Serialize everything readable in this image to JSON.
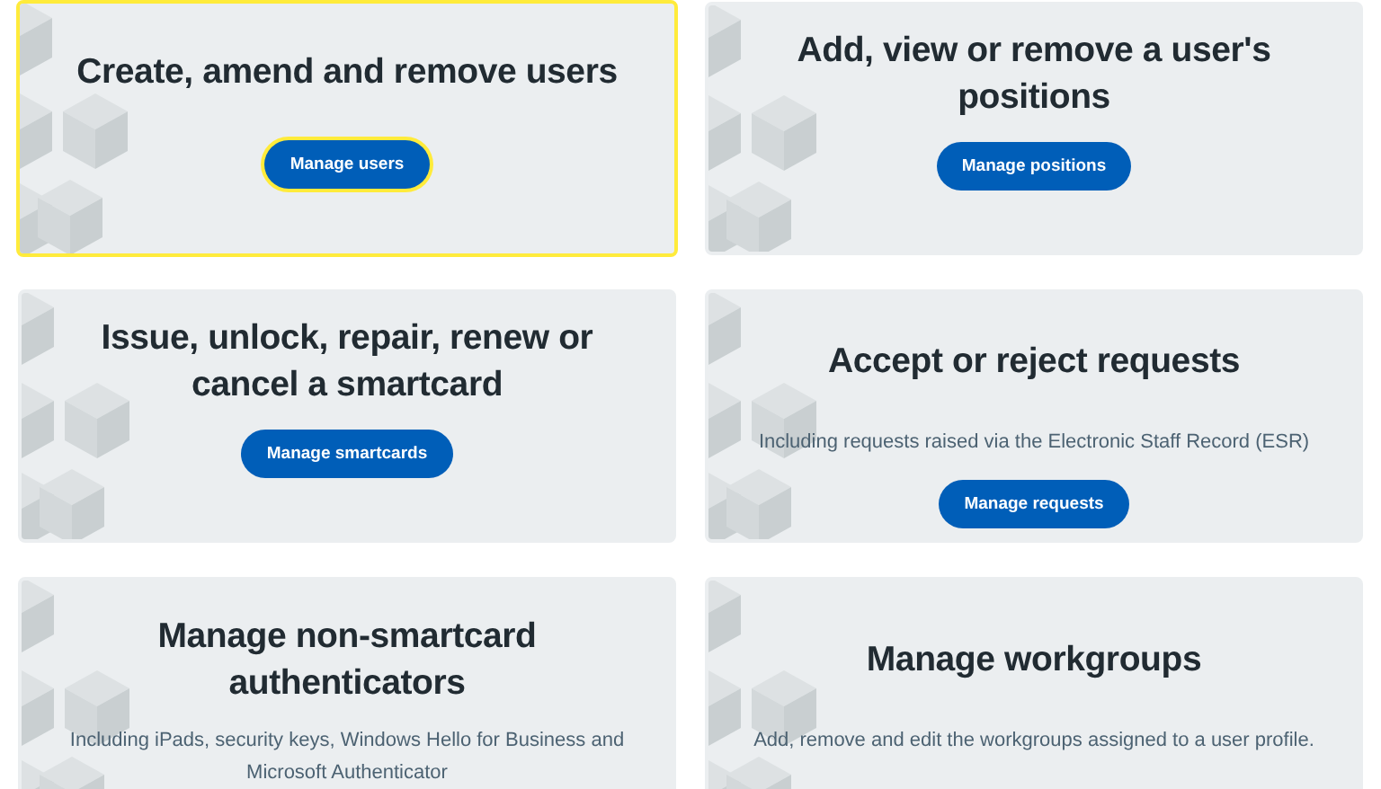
{
  "cards": [
    {
      "title": "Create, amend and remove users",
      "button": "Manage users",
      "focused": true
    },
    {
      "title": "Add, view or remove a user's positions",
      "button": "Manage positions",
      "focused": false
    },
    {
      "title": "Issue, unlock, repair, renew or cancel a smartcard",
      "button": "Manage smartcards",
      "focused": false
    },
    {
      "title": "Accept or reject requests",
      "description": "Including requests raised via the Electronic Staff Record (ESR)",
      "button": "Manage requests",
      "focused": false
    },
    {
      "title": "Manage non-smartcard authenticators",
      "description": "Including iPads, security keys, Windows Hello for Business and Microsoft Authenticator",
      "focused": false
    },
    {
      "title": "Manage workgroups",
      "description": "Add, remove and edit the workgroups assigned to a user profile.",
      "focused": false
    }
  ]
}
